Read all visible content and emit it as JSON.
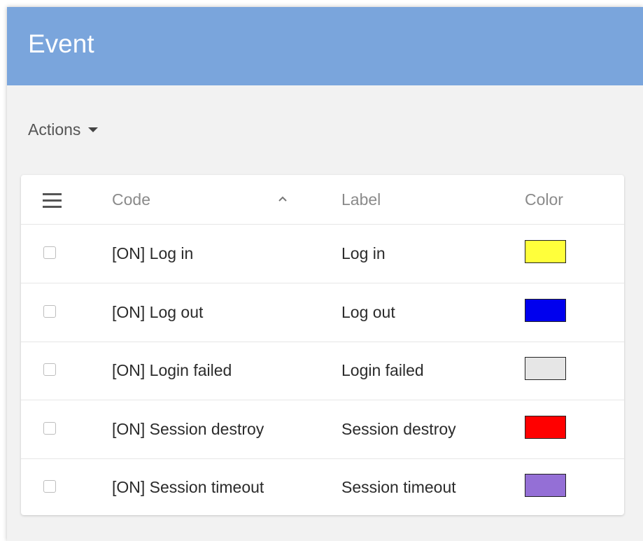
{
  "header": {
    "title": "Event"
  },
  "toolbar": {
    "actions_label": "Actions"
  },
  "table": {
    "columns": {
      "code": "Code",
      "label": "Label",
      "color": "Color"
    },
    "sort": {
      "column": "code",
      "direction": "ascending",
      "icon": "chevron-up-icon"
    },
    "rows": [
      {
        "code": "[ON] Log in",
        "label": "Log in",
        "color": "#ffff3b",
        "checked": false
      },
      {
        "code": "[ON] Log out",
        "label": "Log out",
        "color": "#0000ee",
        "checked": false
      },
      {
        "code": "[ON] Login failed",
        "label": "Login failed",
        "color": "#e6e6e6",
        "checked": false
      },
      {
        "code": "[ON] Session destroy",
        "label": "Session destroy",
        "color": "#ff0000",
        "checked": false
      },
      {
        "code": "[ON] Session timeout",
        "label": "Session timeout",
        "color": "#946fd6",
        "checked": false
      }
    ]
  },
  "colors": {
    "header_bg": "#7aa5dc",
    "page_bg": "#f2f2f2"
  }
}
